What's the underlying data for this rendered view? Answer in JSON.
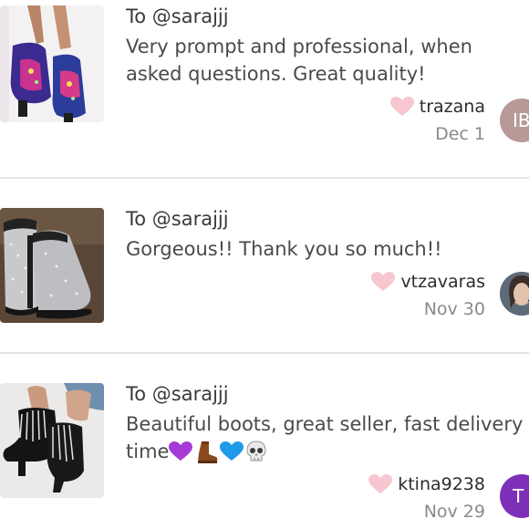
{
  "reviews": [
    {
      "to": "To @sarajjj",
      "comment": "Very prompt and professional, when asked questions. Great quality!",
      "username": "trazana",
      "date": "Dec 1",
      "avatar_initials": "IB",
      "avatar_color": "#b79a97"
    },
    {
      "to": "To @sarajjj",
      "comment": "Gorgeous!! Thank you so much!!",
      "username": "vtzavaras",
      "date": "Nov 30",
      "avatar_initials": "",
      "avatar_color": "#6f7a86"
    },
    {
      "to": "To @sarajjj",
      "comment": "Beautiful boots, great seller, fast delivery time",
      "comment_emojis": [
        "purple-heart",
        "boot",
        "blue-heart",
        "skull"
      ],
      "username": "ktina9238",
      "date": "Nov 29",
      "avatar_initials": "T",
      "avatar_color": "#7e2fb8"
    }
  ],
  "colors": {
    "heart": "#f7c6d0",
    "divider": "#e3e3e3",
    "date": "#8a8a8a"
  }
}
